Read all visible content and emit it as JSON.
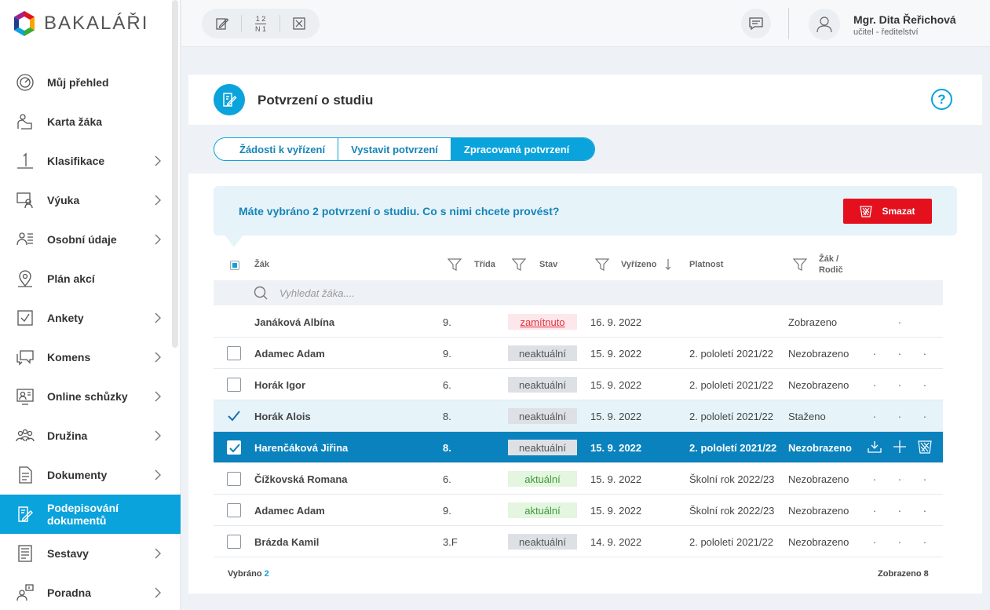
{
  "app": {
    "name": "BAKALÁŘI"
  },
  "sidebar": {
    "items": [
      {
        "label": "Můj přehled",
        "icon": "gauge-icon",
        "chevron": false
      },
      {
        "label": "Karta žáka",
        "icon": "student-card-icon",
        "chevron": false
      },
      {
        "label": "Klasifikace",
        "icon": "grade-one-icon",
        "chevron": true
      },
      {
        "label": "Výuka",
        "icon": "teaching-icon",
        "chevron": true
      },
      {
        "label": "Osobní údaje",
        "icon": "personal-data-icon",
        "chevron": true
      },
      {
        "label": "Plán akcí",
        "icon": "map-pin-icon",
        "chevron": false
      },
      {
        "label": "Ankety",
        "icon": "poll-icon",
        "chevron": true
      },
      {
        "label": "Komens",
        "icon": "messages-icon",
        "chevron": true
      },
      {
        "label": "Online schůzky",
        "icon": "video-meeting-icon",
        "chevron": true
      },
      {
        "label": "Družina",
        "icon": "group-icon",
        "chevron": true
      },
      {
        "label": "Dokumenty",
        "icon": "document-icon",
        "chevron": true
      },
      {
        "label": "Podepisování dokumentů",
        "icon": "sign-document-icon",
        "chevron": false,
        "active": true
      },
      {
        "label": "Sestavy",
        "icon": "report-icon",
        "chevron": true
      },
      {
        "label": "Poradna",
        "icon": "counseling-icon",
        "chevron": true
      }
    ]
  },
  "topbar": {
    "tools": [
      "edit-icon",
      "fraction-icon",
      "close-box-icon"
    ],
    "fraction_top": "1 2",
    "fraction_bottom": "N 1",
    "user_name": "Mgr. Dita Řeřichová",
    "user_role": "učitel - ředitelství"
  },
  "page": {
    "title": "Potvrzení o studiu",
    "help": "?",
    "tabs": [
      {
        "label": "Žádosti k vyřízení",
        "active": false
      },
      {
        "label": "Vystavit potvrzení",
        "active": false
      },
      {
        "label": "Zpracovaná potvrzení",
        "active": true
      }
    ],
    "alert_text": "Máte vybráno 2 potvrzení o studiu. Co s nimi chcete provést?",
    "delete_label": "Smazat"
  },
  "table": {
    "headers": {
      "student": "Žák",
      "class": "Třída",
      "state": "Stav",
      "resolved": "Vyřízeno",
      "validity": "Platnost",
      "student_parent_1": "Žák /",
      "student_parent_2": "Rodič"
    },
    "search_placeholder": "Vyhledat žáka....",
    "rows": [
      {
        "name": "Janáková Albína",
        "class": "9.",
        "state": "zamítnuto",
        "state_type": "zamitnuto",
        "date": "16. 9. 2022",
        "validity": "",
        "seen": "Zobrazeno",
        "checkbox": "none",
        "style": "",
        "actions": [
          "·"
        ]
      },
      {
        "name": "Adamec Adam",
        "class": "9.",
        "state": "neaktuální",
        "state_type": "neaktualni",
        "date": "15. 9. 2022",
        "validity": "2. pololetí 2021/22",
        "seen": "Nezobrazeno",
        "checkbox": "unchecked",
        "style": "",
        "actions": [
          "·",
          "·",
          "·"
        ]
      },
      {
        "name": "Horák Igor",
        "class": "6.",
        "state": "neaktuální",
        "state_type": "neaktualni",
        "date": "15. 9. 2022",
        "validity": "2. pololetí 2021/22",
        "seen": "Nezobrazeno",
        "checkbox": "unchecked",
        "style": "",
        "actions": [
          "·",
          "·",
          "·"
        ]
      },
      {
        "name": "Horák Alois",
        "class": "8.",
        "state": "neaktuální",
        "state_type": "neaktualni",
        "date": "15. 9. 2022",
        "validity": "2. pololetí 2021/22",
        "seen": "Staženo",
        "checkbox": "checked-plain",
        "style": "light",
        "actions": [
          "·",
          "·",
          "·"
        ]
      },
      {
        "name": "Harenčáková Jiřina",
        "class": "8.",
        "state": "neaktuální",
        "state_type": "neaktualni",
        "date": "15. 9. 2022",
        "validity": "2. pololetí 2021/22",
        "seen": "Nezobrazeno",
        "checkbox": "checked-dark",
        "style": "dark",
        "actions": [
          "download-icon",
          "plus-icon",
          "trash-icon"
        ]
      },
      {
        "name": "Čížkovská Romana",
        "class": "6.",
        "state": "aktuální",
        "state_type": "aktualni",
        "date": "15. 9. 2022",
        "validity": "Školní rok 2022/23",
        "seen": "Nezobrazeno",
        "checkbox": "unchecked",
        "style": "",
        "actions": [
          "·",
          "·",
          "·"
        ]
      },
      {
        "name": "Adamec Adam",
        "class": "9.",
        "state": "aktuální",
        "state_type": "aktualni",
        "date": "15. 9. 2022",
        "validity": "Školní rok 2022/23",
        "seen": "Nezobrazeno",
        "checkbox": "unchecked",
        "style": "",
        "actions": [
          "·",
          "·",
          "·"
        ]
      },
      {
        "name": "Brázda Kamil",
        "class": "3.F",
        "state": "neaktuální",
        "state_type": "neaktualni",
        "date": "14. 9. 2022",
        "validity": "2. pololetí 2021/22",
        "seen": "Nezobrazeno",
        "checkbox": "unchecked",
        "style": "",
        "actions": [
          "·",
          "·",
          "·"
        ]
      }
    ],
    "footer_selected_label": "Vybráno",
    "footer_selected_count": "2",
    "footer_shown": "Zobrazeno 8"
  },
  "colors": {
    "accent": "#0aa3dc",
    "selected_row": "#0a82bd",
    "danger": "#e4101e"
  }
}
